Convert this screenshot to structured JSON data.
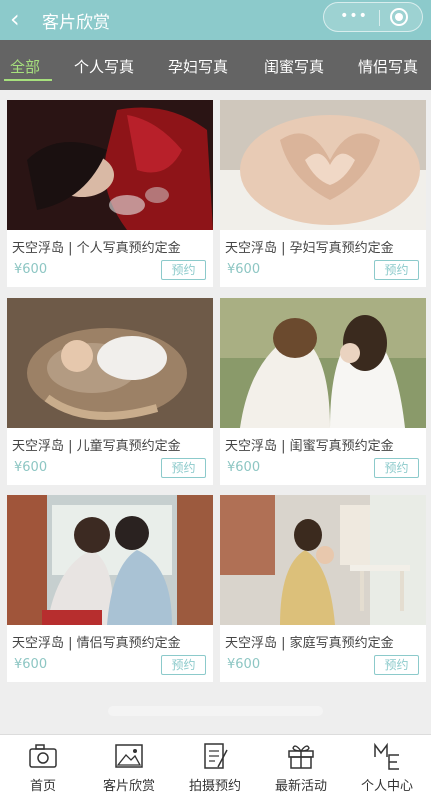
{
  "header": {
    "back_icon": "chevron-left-icon",
    "title": "客片欣赏",
    "more_icon": "more-dots-icon",
    "close_icon": "target-circle-icon",
    "color": "#8ccacb"
  },
  "tabs": [
    {
      "label": "全部",
      "active": true
    },
    {
      "label": "个人写真",
      "active": false
    },
    {
      "label": "孕妇写真",
      "active": false
    },
    {
      "label": "闺蜜写真",
      "active": false
    },
    {
      "label": "情侣写真",
      "active": false
    }
  ],
  "tab_active_color": "#a6e07d",
  "products": [
    {
      "title": "天空浮岛 | 个人写真预约定金",
      "price": "¥600",
      "button": "预约"
    },
    {
      "title": "天空浮岛 | 孕妇写真预约定金",
      "price": "¥600",
      "button": "预约"
    },
    {
      "title": "天空浮岛 | 儿童写真预约定金",
      "price": "¥600",
      "button": "预约"
    },
    {
      "title": "天空浮岛 | 闺蜜写真预约定金",
      "price": "¥600",
      "button": "预约"
    },
    {
      "title": "天空浮岛 | 情侣写真预约定金",
      "price": "¥600",
      "button": "预约"
    },
    {
      "title": "天空浮岛 | 家庭写真预约定金",
      "price": "¥600",
      "button": "预约"
    }
  ],
  "bottom_nav": [
    {
      "label": "首页",
      "icon": "camera-icon"
    },
    {
      "label": "客片欣赏",
      "icon": "picture-frame-icon"
    },
    {
      "label": "拍摄预约",
      "icon": "notepad-pen-icon"
    },
    {
      "label": "最新活动",
      "icon": "gift-box-icon"
    },
    {
      "label": "个人中心",
      "icon": "me-icon"
    }
  ]
}
